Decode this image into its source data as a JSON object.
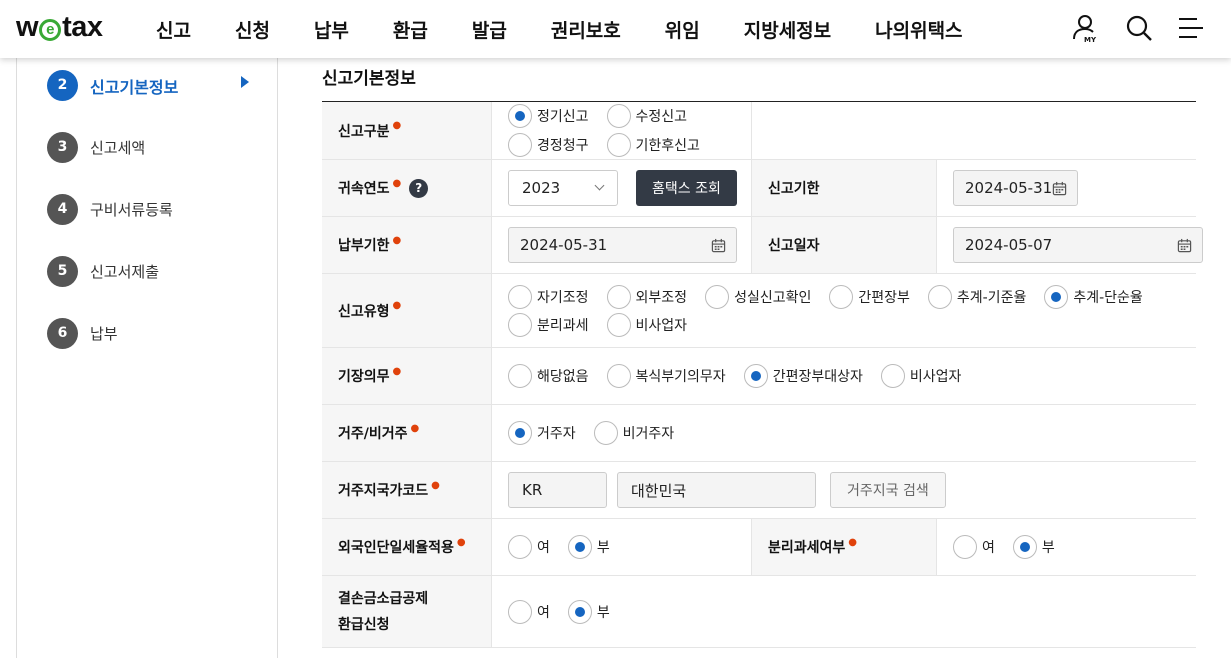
{
  "header": {
    "logo_pre": "w",
    "logo_mark": "e",
    "logo_post": "tax",
    "nav": [
      "신고",
      "신청",
      "납부",
      "환급",
      "발급",
      "권리보호",
      "위임",
      "지방세정보",
      "나의위택스"
    ],
    "my_label": "MY"
  },
  "sidebar": {
    "steps": [
      {
        "num": "2",
        "label": "신고기본정보"
      },
      {
        "num": "3",
        "label": "신고세액"
      },
      {
        "num": "4",
        "label": "구비서류등록"
      },
      {
        "num": "5",
        "label": "신고서제출"
      },
      {
        "num": "6",
        "label": "납부"
      }
    ]
  },
  "section_title": "신고기본정보",
  "form": {
    "filing_type": {
      "label": "신고구분",
      "options": [
        "정기신고",
        "수정신고",
        "경정청구",
        "기한후신고"
      ],
      "selected": 0
    },
    "tax_year": {
      "label": "귀속연도",
      "help": "?",
      "value": "2023",
      "hometax_button": "홈택스 조회"
    },
    "filing_deadline": {
      "label": "신고기한",
      "value": "2024-05-31"
    },
    "payment_deadline": {
      "label": "납부기한",
      "value": "2024-05-31"
    },
    "filing_date": {
      "label": "신고일자",
      "value": "2024-05-07"
    },
    "return_type": {
      "label": "신고유형",
      "options": [
        "자기조정",
        "외부조정",
        "성실신고확인",
        "간편장부",
        "추계-기준율",
        "추계-단순율",
        "분리과세",
        "비사업자"
      ],
      "selected": 5
    },
    "bookkeeping": {
      "label": "기장의무",
      "options": [
        "해당없음",
        "복식부기의무자",
        "간편장부대상자",
        "비사업자"
      ],
      "selected": 2
    },
    "residency": {
      "label": "거주/비거주",
      "options": [
        "거주자",
        "비거주자"
      ],
      "selected": 0
    },
    "country_code": {
      "label": "거주지국가코드",
      "code": "KR",
      "name": "대한민국",
      "search_button": "거주지국 검색"
    },
    "flat_rate": {
      "label": "외국인단일세율적용",
      "options": [
        "여",
        "부"
      ],
      "selected": 1
    },
    "separate_tax": {
      "label": "분리과세여부",
      "options": [
        "여",
        "부"
      ],
      "selected": 1
    },
    "loss_refund": {
      "label_line1": "결손금소급공제",
      "label_line2": "환급신청",
      "options": [
        "여",
        "부"
      ],
      "selected": 1
    }
  },
  "colors": {
    "accent": "#1565c0",
    "required": "#e0420b",
    "dark_button": "#333a45",
    "logo_green": "#39a935"
  }
}
